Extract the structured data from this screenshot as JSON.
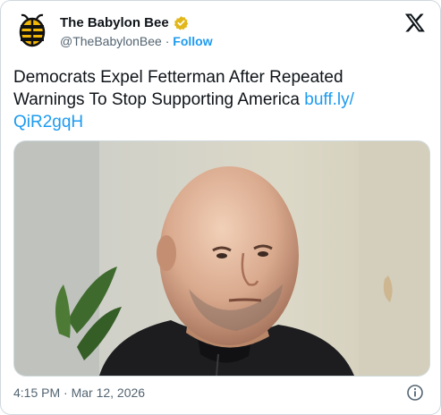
{
  "account": {
    "display_name": "The Babylon Bee",
    "handle": "@TheBabylonBee",
    "separator": " · ",
    "follow_label": "Follow"
  },
  "tweet": {
    "text": "Democrats Expel Fetterman After Repeated Warnings To Stop Supporting America",
    "link_line1": "buff.ly/",
    "link_line2": "QiR2gqH"
  },
  "footer": {
    "timestamp": "4:15 PM · Mar 12, 2026"
  },
  "colors": {
    "accent": "#1d9bf0",
    "verified_badge": "#e2b719",
    "text": "#0f1419",
    "muted": "#536471"
  },
  "icons": {
    "avatar": "bee-logo-icon",
    "verified": "verified-badge-icon",
    "platform": "x-logo-icon",
    "info": "info-icon"
  }
}
